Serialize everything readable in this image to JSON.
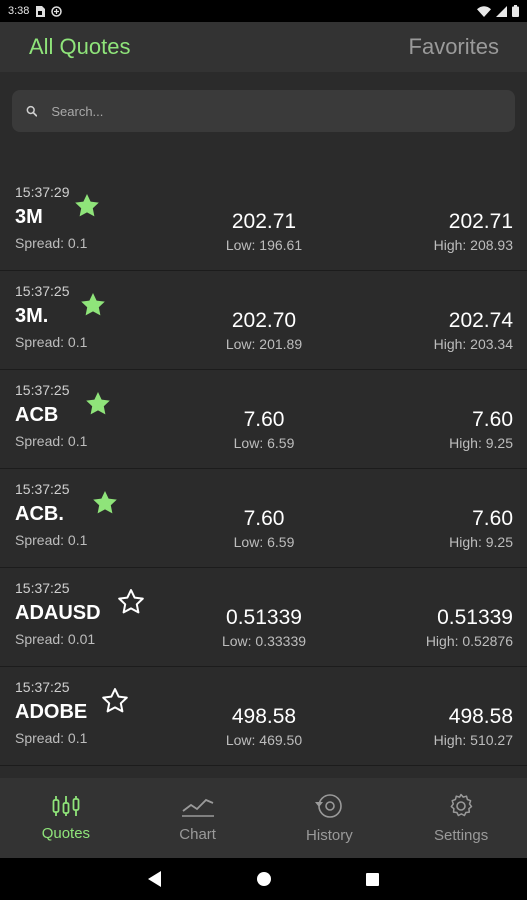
{
  "status_bar": {
    "time": "3:38"
  },
  "top_tabs": {
    "all_quotes": "All Quotes",
    "favorites": "Favorites"
  },
  "search": {
    "placeholder": "Search..."
  },
  "quotes": [
    {
      "time": "15:37:29",
      "symbol": "3M",
      "favorite": true,
      "spread": "Spread: 0.1",
      "bid": "202.71",
      "low": "Low: 196.61",
      "ask": "202.71",
      "high": "High: 208.93"
    },
    {
      "time": "15:37:25",
      "symbol": "3M.",
      "favorite": true,
      "spread": "Spread: 0.1",
      "bid": "202.70",
      "low": "Low: 201.89",
      "ask": "202.74",
      "high": "High: 203.34"
    },
    {
      "time": "15:37:25",
      "symbol": "ACB",
      "favorite": true,
      "spread": "Spread: 0.1",
      "bid": "7.60",
      "low": "Low: 6.59",
      "ask": "7.60",
      "high": "High: 9.25"
    },
    {
      "time": "15:37:25",
      "symbol": "ACB.",
      "favorite": true,
      "spread": "Spread: 0.1",
      "bid": "7.60",
      "low": "Low: 6.59",
      "ask": "7.60",
      "high": "High: 9.25"
    },
    {
      "time": "15:37:25",
      "symbol": "ADAUSD",
      "favorite": false,
      "spread": "Spread: 0.01",
      "bid": "0.51339",
      "low": "Low: 0.33339",
      "ask": "0.51339",
      "high": "High: 0.52876"
    },
    {
      "time": "15:37:25",
      "symbol": "ADOBE",
      "favorite": false,
      "spread": "Spread: 0.1",
      "bid": "498.58",
      "low": "Low: 469.50",
      "ask": "498.58",
      "high": "High: 510.27"
    },
    {
      "time": "15:37:25",
      "symbol": "",
      "favorite": false,
      "spread": "",
      "bid": "",
      "low": "",
      "ask": "",
      "high": ""
    }
  ],
  "bottom_nav": {
    "quotes": "Quotes",
    "chart": "Chart",
    "history": "History",
    "settings": "Settings"
  },
  "colors": {
    "accent": "#8fe47a",
    "background": "#2b2b2b",
    "bar": "#333333"
  }
}
